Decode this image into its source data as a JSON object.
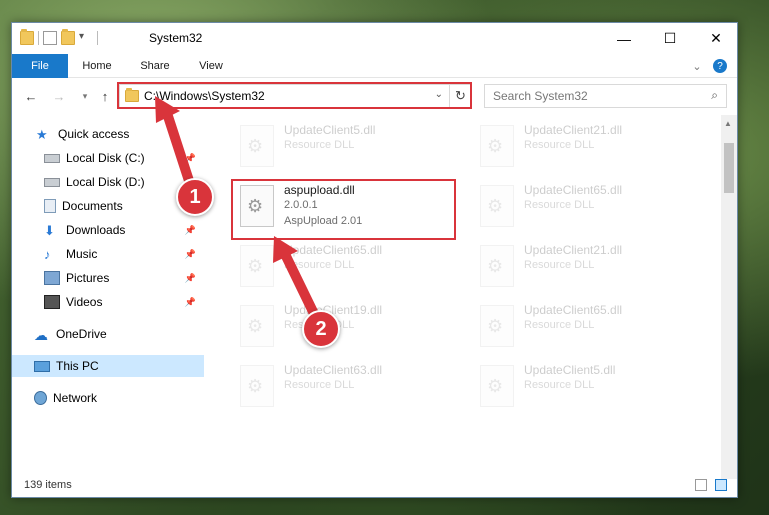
{
  "window": {
    "title": "System32"
  },
  "ribbon": {
    "tabs": [
      "File",
      "Home",
      "Share",
      "View"
    ]
  },
  "address": {
    "path": "C:\\Windows\\System32",
    "search_placeholder": "Search System32"
  },
  "sidebar": {
    "items": [
      {
        "label": "Quick access",
        "icon": "star-icon"
      },
      {
        "label": "Local Disk (C:)",
        "icon": "drive-icon",
        "pinned": true
      },
      {
        "label": "Local Disk (D:)",
        "icon": "drive-icon"
      },
      {
        "label": "Documents",
        "icon": "documents-icon"
      },
      {
        "label": "Downloads",
        "icon": "download-icon",
        "pinned": true
      },
      {
        "label": "Music",
        "icon": "music-icon",
        "pinned": true
      },
      {
        "label": "Pictures",
        "icon": "pictures-icon",
        "pinned": true
      },
      {
        "label": "Videos",
        "icon": "videos-icon",
        "pinned": true
      },
      {
        "label": "OneDrive",
        "icon": "cloud-icon"
      },
      {
        "label": "This PC",
        "icon": "computer-icon",
        "selected": true
      },
      {
        "label": "Network",
        "icon": "network-icon"
      }
    ]
  },
  "files": {
    "main": {
      "name": "aspupload.dll",
      "version": "2.0.0.1",
      "description": "AspUpload 2.01"
    },
    "faded": [
      {
        "name": "UpdateClient5.dll",
        "type": "Resource DLL"
      },
      {
        "name": "UpdateClient21.dll",
        "type": "Resource DLL"
      },
      {
        "name": "UpdateClient65.dll",
        "type": "Resource DLL"
      },
      {
        "name": "UpdateClient65.dll",
        "type": "Resource DLL"
      },
      {
        "name": "UpdateClient21.dll",
        "type": "Resource DLL"
      },
      {
        "name": "UpdateClient19.dll",
        "type": "Resource DLL"
      },
      {
        "name": "UpdateClient65.dll",
        "type": "Resource DLL"
      },
      {
        "name": "UpdateClient63.dll",
        "type": "Resource DLL"
      },
      {
        "name": "UpdateClient5.dll",
        "type": "Resource DLL"
      }
    ]
  },
  "status": {
    "items_count": "139 items"
  },
  "annotations": {
    "step1": "1",
    "step2": "2"
  },
  "colors": {
    "accent": "#1979ca",
    "highlight": "#d9343b"
  }
}
